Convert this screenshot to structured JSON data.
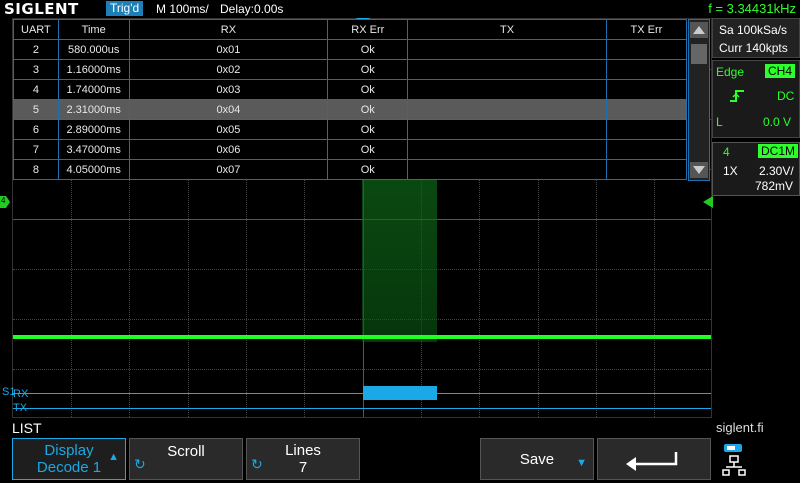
{
  "topbar": {
    "brand": "SIGLENT",
    "trig_status": "Trig'd",
    "timebase": "M 100ms/",
    "delay": "Delay:0.00s",
    "frequency": "f = 3.34431kHz"
  },
  "decode_table": {
    "headers": [
      "UART",
      "Time",
      "RX",
      "RX Err",
      "TX",
      "TX Err"
    ],
    "rows": [
      {
        "idx": "2",
        "time": "580.000us",
        "rx": "0x01",
        "rx_err": "Ok",
        "tx": "",
        "tx_err": ""
      },
      {
        "idx": "3",
        "time": "1.16000ms",
        "rx": "0x02",
        "rx_err": "Ok",
        "tx": "",
        "tx_err": ""
      },
      {
        "idx": "4",
        "time": "1.74000ms",
        "rx": "0x03",
        "rx_err": "Ok",
        "tx": "",
        "tx_err": ""
      },
      {
        "idx": "5",
        "time": "2.31000ms",
        "rx": "0x04",
        "rx_err": "Ok",
        "tx": "",
        "tx_err": ""
      },
      {
        "idx": "6",
        "time": "2.89000ms",
        "rx": "0x05",
        "rx_err": "Ok",
        "tx": "",
        "tx_err": ""
      },
      {
        "idx": "7",
        "time": "3.47000ms",
        "rx": "0x06",
        "rx_err": "Ok",
        "tx": "",
        "tx_err": ""
      },
      {
        "idx": "8",
        "time": "4.05000ms",
        "rx": "0x07",
        "rx_err": "Ok",
        "tx": "",
        "tx_err": ""
      }
    ],
    "selected_row": 3
  },
  "channel_marker": "4",
  "bus": {
    "name": "S1",
    "rx_label": "RX",
    "tx_label": "TX"
  },
  "right_panel": {
    "sample_rate": "Sa 100kSa/s",
    "memory": "Curr 140kpts",
    "trigger_type": "Edge",
    "trigger_source": "CH4",
    "trigger_slope_icon": "rising-edge-icon",
    "trigger_coupling": "DC",
    "trigger_level_label": "L",
    "trigger_level": "0.0 V",
    "channel_number": "4",
    "channel_coupling": "DC1M",
    "probe": "1X",
    "volts_div": "2.30V/",
    "offset": "782mV"
  },
  "menu": {
    "title": "LIST",
    "watermark": "siglent.fi",
    "display_label": "Display",
    "display_value": "Decode 1",
    "scroll_label": "Scroll",
    "lines_label": "Lines",
    "lines_value": "7",
    "save_label": "Save"
  },
  "colors": {
    "accent": "#1aa9e6",
    "channel4": "#22ff22",
    "table_border": "#1d6fb0",
    "selected_row": "#5a5a5a"
  }
}
